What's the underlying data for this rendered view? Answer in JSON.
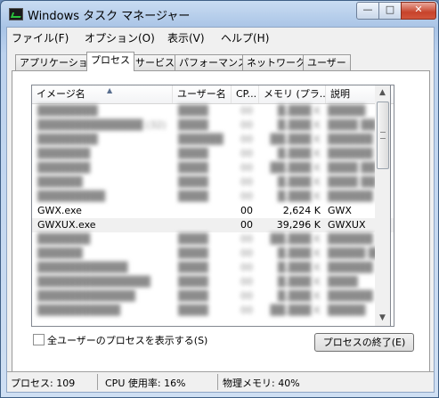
{
  "window": {
    "title": "Windows タスク マネージャー"
  },
  "caption_buttons": {
    "minimize": "—",
    "maximize": "□",
    "close": "✕"
  },
  "menu": [
    "ファイル(F)",
    "オプション(O)",
    "表示(V)",
    "ヘルプ(H)"
  ],
  "tabs": [
    "アプリケーション",
    "プロセス",
    "サービス",
    "パフォーマンス",
    "ネットワーク",
    "ユーザー"
  ],
  "active_tab": "プロセス",
  "columns": [
    "イメージ名",
    "ユーザー名",
    "CP...",
    "メモリ (プラ...",
    "説明"
  ],
  "rows": [
    {
      "name": "████████",
      "user": "████",
      "cpu": "00",
      "mem": "█,███ K",
      "desc": "█████",
      "blurred": true
    },
    {
      "name": "██████████████ (32)",
      "user": "████",
      "cpu": "00",
      "mem": "█,███ K",
      "desc": "████ ██",
      "blurred": true
    },
    {
      "name": "████████",
      "user": "██████",
      "cpu": "00",
      "mem": "██,███ K",
      "desc": "██████",
      "blurred": true
    },
    {
      "name": "███████",
      "user": "████",
      "cpu": "00",
      "mem": "█,███ K",
      "desc": "██████",
      "blurred": true
    },
    {
      "name": "███████",
      "user": "████",
      "cpu": "00",
      "mem": "██,███ K",
      "desc": "████ ██",
      "blurred": true
    },
    {
      "name": "██████",
      "user": "████",
      "cpu": "00",
      "mem": "█,███ K",
      "desc": "████ ██",
      "blurred": true
    },
    {
      "name": "█████████",
      "user": "████",
      "cpu": "00",
      "mem": "█,███ K",
      "desc": "██████",
      "blurred": true
    },
    {
      "name": "GWX.exe",
      "user": "",
      "cpu": "00",
      "mem": "2,624 K",
      "desc": "GWX",
      "blurred": false
    },
    {
      "name": "GWXUX.exe",
      "user": "",
      "cpu": "00",
      "mem": "39,296 K",
      "desc": "GWXUX",
      "blurred": false,
      "selected": true
    },
    {
      "name": "███████",
      "user": "████",
      "cpu": "00",
      "mem": "██,███ K",
      "desc": "██████",
      "blurred": true
    },
    {
      "name": "██████",
      "user": "████",
      "cpu": "00",
      "mem": "█,███ K",
      "desc": "█████ ██",
      "blurred": true
    },
    {
      "name": "████████████",
      "user": "████",
      "cpu": "00",
      "mem": "█,███ K",
      "desc": "██████",
      "blurred": true
    },
    {
      "name": "███████████████",
      "user": "████",
      "cpu": "00",
      "mem": "█,███ K",
      "desc": "████",
      "blurred": true
    },
    {
      "name": "█████████████",
      "user": "████",
      "cpu": "00",
      "mem": "█,███ K",
      "desc": "██████",
      "blurred": true
    },
    {
      "name": "███████████",
      "user": "████",
      "cpu": "00",
      "mem": "██,███ K",
      "desc": "█████",
      "blurred": true
    }
  ],
  "show_all_users_label": "全ユーザーのプロセスを表示する(S)",
  "end_process_label": "プロセスの終了(E)",
  "status": {
    "processes": "プロセス: 109",
    "cpu": "CPU 使用率: 16%",
    "memory": "物理メモリ: 40%"
  }
}
